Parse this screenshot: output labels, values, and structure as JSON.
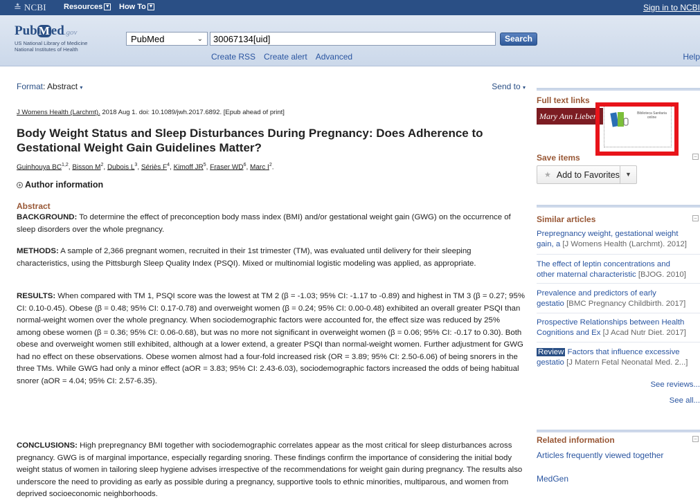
{
  "topbar": {
    "logo_text": "NCBI",
    "resources": "Resources",
    "howto": "How To",
    "signin": "Sign in to NCBI"
  },
  "header": {
    "logo_main_left": "Pub",
    "logo_main_m": "M",
    "logo_main_right": "ed",
    "logo_gov": ".gov",
    "logo_sub1": "US National Library of Medicine",
    "logo_sub2": "National Institutes of Health",
    "db_value": "PubMed",
    "search_value": "30067134[uid]",
    "search_button": "Search",
    "links": [
      "Create RSS",
      "Create alert",
      "Advanced"
    ],
    "help": "Help"
  },
  "main": {
    "format_label": "Format",
    "format_value": ": Abstract",
    "send_to": "Send to",
    "citation_journal": "J Womens Health (Larchmt).",
    "citation_rest": " 2018 Aug 1. doi: 10.1089/jwh.2017.6892. [Epub ahead of print]",
    "title": "Body Weight Status and Sleep Disturbances During Pregnancy: Does Adherence to Gestational Weight Gain Guidelines Matter?",
    "authors": [
      {
        "name": "Guinhouya BC",
        "sup": "1,2"
      },
      {
        "name": "Bisson M",
        "sup": "2"
      },
      {
        "name": "Dubois L",
        "sup": "3"
      },
      {
        "name": "Sériès F",
        "sup": "4"
      },
      {
        "name": "Kimoff JR",
        "sup": "5"
      },
      {
        "name": "Fraser WD",
        "sup": "6"
      },
      {
        "name": "Marc I",
        "sup": "2"
      }
    ],
    "author_info": "Author information",
    "abstract_heading": "Abstract",
    "abstract": [
      {
        "label": "BACKGROUND:",
        "text": " To determine the effect of preconception body mass index (BMI) and/or gestational weight gain (GWG) on the occurrence of sleep disorders over the whole pregnancy."
      },
      {
        "label": "METHODS:",
        "text": " A sample of 2,366 pregnant women, recruited in their 1st trimester (TM), was evaluated until delivery for their sleeping characteristics, using the Pittsburgh Sleep Quality Index (PSQI). Mixed or multinomial logistic modeling was applied, as appropriate."
      },
      {
        "label": "RESULTS:",
        "text": " When compared with TM 1, PSQI score was the lowest at TM 2 (β = -1.03; 95% CI: -1.17 to -0.89) and highest in TM 3 (β = 0.27; 95% CI: 0.10-0.45). Obese (β = 0.48; 95% CI: 0.17-0.78) and overweight women (β = 0.24; 95% CI: 0.00-0.48) exhibited an overall greater PSQI than normal-weight women over the whole pregnancy. When sociodemographic factors were accounted for, the effect size was reduced by 25% among obese women (β = 0.36; 95% CI: 0.06-0.68), but was no more not significant in overweight women (β = 0.06; 95% CI: -0.17 to 0.30). Both obese and overweight women still exhibited, although at a lower extend, a greater PSQI than normal-weight women. Further adjustment for GWG had no effect on these observations. Obese women almost had a four-fold increased risk (OR = 3.89; 95% CI: 2.50-6.06) of being snorers in the three TMs. While GWG had only a minor effect (aOR = 3.83; 95% CI: 2.43-6.03), sociodemographic factors increased the odds of being habitual snorer (aOR = 4.04; 95% CI: 2.57-6.35)."
      },
      {
        "label": "CONCLUSIONS:",
        "text": " High prepregnancy BMI together with sociodemographic correlates appear as the most critical for sleep disturbances across pregnancy. GWG is of marginal importance, especially regarding snoring. These findings confirm the importance of considering the initial body weight status of women in tailoring sleep hygiene advises irrespective of the recommendations for weight gain during pregnancy. The results also underscore the need to providing as early as possible during a pregnancy, supportive tools to ethnic minorities, multiparous, and women from deprived socioeconomic neighborhoods."
      }
    ]
  },
  "sidebar": {
    "full_text_heading": "Full text links",
    "publisher_logo": "Mary Ann Liebert",
    "library_logo": "Biblioteca Sanitaria online",
    "save_heading": "Save items",
    "add_favorites": "Add to Favorites",
    "similar_heading": "Similar articles",
    "similar": [
      {
        "line1": "Prepregnancy weight, gestational weight",
        "line2_title": "gain, a",
        "line2_src": "[J Womens Health (Larchmt). 2012]",
        "review": ""
      },
      {
        "line1": "The effect of leptin concentrations and",
        "line2_title": "other maternal characteristic",
        "line2_src": "[BJOG. 2010]",
        "review": ""
      },
      {
        "line1": "Prevalence and predictors of early",
        "line2_title": "gestatio",
        "line2_src": "[BMC Pregnancy Childbirth. 2017]",
        "review": ""
      },
      {
        "line1": "Prospective Relationships between Health",
        "line2_title": "Cognitions and Ex",
        "line2_src": "[J Acad Nutr Diet. 2017]",
        "review": ""
      },
      {
        "line1": "Factors that influence excessive",
        "line2_title": "gestatio",
        "line2_src": "[J Matern Fetal Neonatal Med. 2...]",
        "review": "Review"
      }
    ],
    "see_reviews": "See reviews...",
    "see_all": "See all...",
    "related_heading": "Related information",
    "related": [
      "Articles frequently viewed together",
      "MedGen"
    ]
  }
}
